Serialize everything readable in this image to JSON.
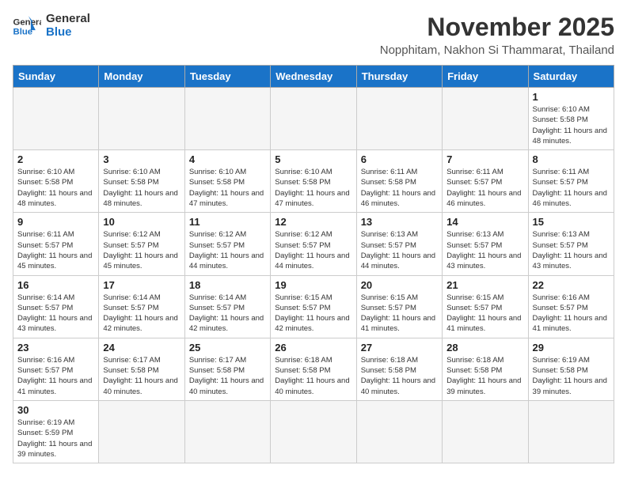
{
  "logo": {
    "line1": "General",
    "line2": "Blue"
  },
  "header": {
    "month": "November 2025",
    "location": "Nopphitam, Nakhon Si Thammarat, Thailand"
  },
  "weekdays": [
    "Sunday",
    "Monday",
    "Tuesday",
    "Wednesday",
    "Thursday",
    "Friday",
    "Saturday"
  ],
  "weeks": [
    [
      {
        "day": null
      },
      {
        "day": null
      },
      {
        "day": null
      },
      {
        "day": null
      },
      {
        "day": null
      },
      {
        "day": null
      },
      {
        "day": 1,
        "sunrise": "6:10 AM",
        "sunset": "5:58 PM",
        "daylight": "11 hours and 48 minutes."
      }
    ],
    [
      {
        "day": 2,
        "sunrise": "6:10 AM",
        "sunset": "5:58 PM",
        "daylight": "11 hours and 48 minutes."
      },
      {
        "day": 3,
        "sunrise": "6:10 AM",
        "sunset": "5:58 PM",
        "daylight": "11 hours and 48 minutes."
      },
      {
        "day": 4,
        "sunrise": "6:10 AM",
        "sunset": "5:58 PM",
        "daylight": "11 hours and 47 minutes."
      },
      {
        "day": 5,
        "sunrise": "6:10 AM",
        "sunset": "5:58 PM",
        "daylight": "11 hours and 47 minutes."
      },
      {
        "day": 6,
        "sunrise": "6:11 AM",
        "sunset": "5:58 PM",
        "daylight": "11 hours and 46 minutes."
      },
      {
        "day": 7,
        "sunrise": "6:11 AM",
        "sunset": "5:57 PM",
        "daylight": "11 hours and 46 minutes."
      },
      {
        "day": 8,
        "sunrise": "6:11 AM",
        "sunset": "5:57 PM",
        "daylight": "11 hours and 46 minutes."
      }
    ],
    [
      {
        "day": 9,
        "sunrise": "6:11 AM",
        "sunset": "5:57 PM",
        "daylight": "11 hours and 45 minutes."
      },
      {
        "day": 10,
        "sunrise": "6:12 AM",
        "sunset": "5:57 PM",
        "daylight": "11 hours and 45 minutes."
      },
      {
        "day": 11,
        "sunrise": "6:12 AM",
        "sunset": "5:57 PM",
        "daylight": "11 hours and 44 minutes."
      },
      {
        "day": 12,
        "sunrise": "6:12 AM",
        "sunset": "5:57 PM",
        "daylight": "11 hours and 44 minutes."
      },
      {
        "day": 13,
        "sunrise": "6:13 AM",
        "sunset": "5:57 PM",
        "daylight": "11 hours and 44 minutes."
      },
      {
        "day": 14,
        "sunrise": "6:13 AM",
        "sunset": "5:57 PM",
        "daylight": "11 hours and 43 minutes."
      },
      {
        "day": 15,
        "sunrise": "6:13 AM",
        "sunset": "5:57 PM",
        "daylight": "11 hours and 43 minutes."
      }
    ],
    [
      {
        "day": 16,
        "sunrise": "6:14 AM",
        "sunset": "5:57 PM",
        "daylight": "11 hours and 43 minutes."
      },
      {
        "day": 17,
        "sunrise": "6:14 AM",
        "sunset": "5:57 PM",
        "daylight": "11 hours and 42 minutes."
      },
      {
        "day": 18,
        "sunrise": "6:14 AM",
        "sunset": "5:57 PM",
        "daylight": "11 hours and 42 minutes."
      },
      {
        "day": 19,
        "sunrise": "6:15 AM",
        "sunset": "5:57 PM",
        "daylight": "11 hours and 42 minutes."
      },
      {
        "day": 20,
        "sunrise": "6:15 AM",
        "sunset": "5:57 PM",
        "daylight": "11 hours and 41 minutes."
      },
      {
        "day": 21,
        "sunrise": "6:15 AM",
        "sunset": "5:57 PM",
        "daylight": "11 hours and 41 minutes."
      },
      {
        "day": 22,
        "sunrise": "6:16 AM",
        "sunset": "5:57 PM",
        "daylight": "11 hours and 41 minutes."
      }
    ],
    [
      {
        "day": 23,
        "sunrise": "6:16 AM",
        "sunset": "5:57 PM",
        "daylight": "11 hours and 41 minutes."
      },
      {
        "day": 24,
        "sunrise": "6:17 AM",
        "sunset": "5:58 PM",
        "daylight": "11 hours and 40 minutes."
      },
      {
        "day": 25,
        "sunrise": "6:17 AM",
        "sunset": "5:58 PM",
        "daylight": "11 hours and 40 minutes."
      },
      {
        "day": 26,
        "sunrise": "6:18 AM",
        "sunset": "5:58 PM",
        "daylight": "11 hours and 40 minutes."
      },
      {
        "day": 27,
        "sunrise": "6:18 AM",
        "sunset": "5:58 PM",
        "daylight": "11 hours and 40 minutes."
      },
      {
        "day": 28,
        "sunrise": "6:18 AM",
        "sunset": "5:58 PM",
        "daylight": "11 hours and 39 minutes."
      },
      {
        "day": 29,
        "sunrise": "6:19 AM",
        "sunset": "5:58 PM",
        "daylight": "11 hours and 39 minutes."
      }
    ],
    [
      {
        "day": 30,
        "sunrise": "6:19 AM",
        "sunset": "5:59 PM",
        "daylight": "11 hours and 39 minutes."
      },
      {
        "day": null
      },
      {
        "day": null
      },
      {
        "day": null
      },
      {
        "day": null
      },
      {
        "day": null
      },
      {
        "day": null
      }
    ]
  ]
}
